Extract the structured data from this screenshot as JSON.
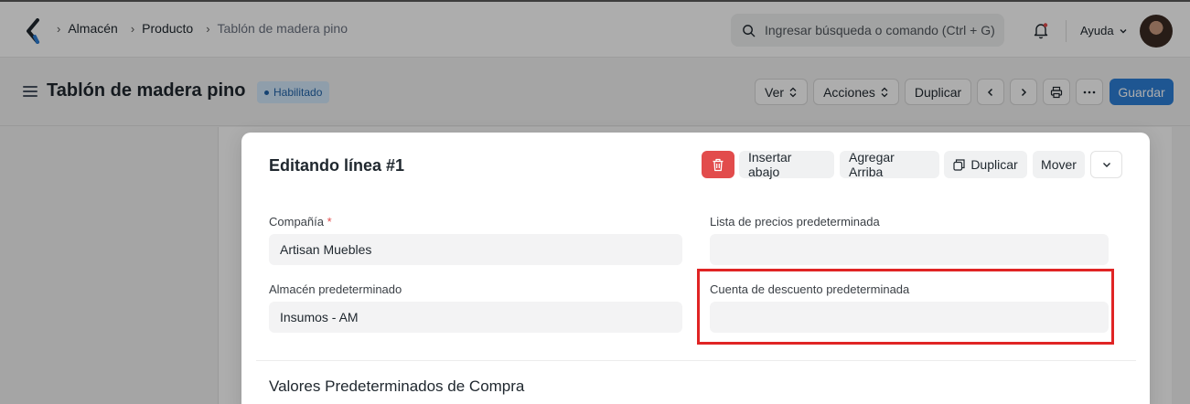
{
  "breadcrumbs": [
    "Almacén",
    "Producto",
    "Tablón de madera pino"
  ],
  "search": {
    "placeholder": "Ingresar búsqueda o comando (Ctrl + G)"
  },
  "nav": {
    "help_label": "Ayuda"
  },
  "page": {
    "title": "Tablón de madera pino",
    "status": "Habilitado",
    "buttons": {
      "view": "Ver",
      "actions": "Acciones",
      "duplicate": "Duplicar",
      "save": "Guardar"
    }
  },
  "dialog": {
    "title": "Editando línea #1",
    "buttons": {
      "insert_below": "Insertar abajo",
      "add_above": "Agregar Arriba",
      "duplicate": "Duplicar",
      "move": "Mover"
    },
    "fields": {
      "company": {
        "label": "Compañía",
        "required_mark": "*",
        "value": "Artisan Muebles"
      },
      "price_list": {
        "label": "Lista de precios predeterminada",
        "value": ""
      },
      "warehouse": {
        "label": "Almacén predeterminado",
        "value": "Insumos - AM"
      },
      "discount_account": {
        "label": "Cuenta de descuento predeterminada",
        "value": ""
      }
    },
    "section_title": "Valores Predeterminados de Compra"
  },
  "colors": {
    "primary": "#2d7fd8",
    "danger": "#e24c4c",
    "badge_bg": "#d3e9fc",
    "badge_text": "#1f62a8",
    "highlight": "#e02424"
  }
}
